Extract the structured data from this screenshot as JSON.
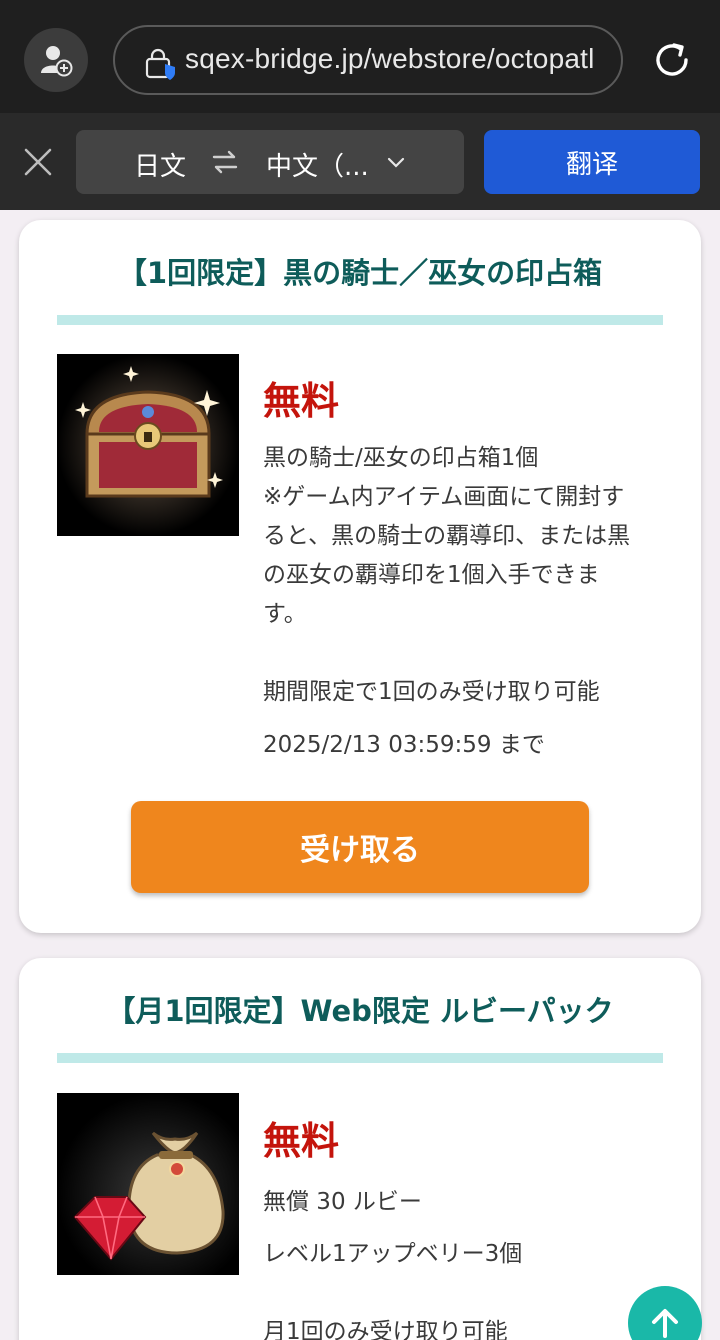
{
  "browser": {
    "url": "sqex-bridge.jp/webstore/octopatl",
    "profile_icon": "profile-add-icon",
    "reload_icon": "reload-icon"
  },
  "translate_bar": {
    "source_lang": "日文",
    "target_lang": "中文（...",
    "translate_label": "翻译"
  },
  "cards": [
    {
      "title": "【1回限定】黒の騎士／巫女の印占箱",
      "price": "無料",
      "description_lines": [
        "黒の騎士/巫女の印占箱1個",
        "※ゲーム内アイテム画面にて開封す",
        "ると、黒の騎士の覇導印、または黒",
        "の巫女の覇導印を1個入手できま",
        "す。"
      ],
      "limit": "期間限定で1回のみ受け取り可能",
      "deadline": "2025/2/13 03:59:59 まで",
      "button_label": "受け取る",
      "image_icon": "treasure-chest-icon"
    },
    {
      "title": "【月1回限定】Web限定 ルビーパック",
      "price": "無料",
      "items": [
        "無償 30 ルビー",
        "レベル1アップベリー3個"
      ],
      "limit": "月1回のみ受け取り可能",
      "image_icon": "ruby-bag-icon"
    }
  ],
  "colors": {
    "title_teal": "#0e5c5a",
    "price_red": "#c4140c",
    "button_orange": "#ef861d",
    "translate_blue": "#1f5ad6",
    "fab_teal": "#1ab8a8"
  }
}
